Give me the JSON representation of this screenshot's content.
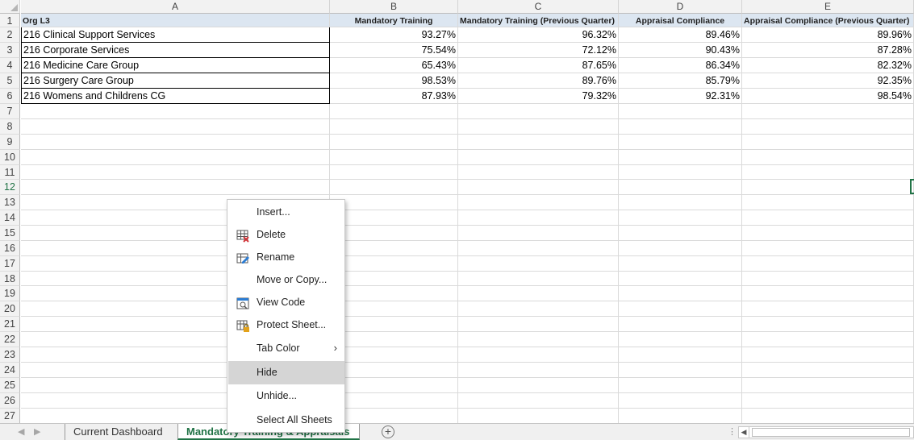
{
  "spreadsheet": {
    "columns": [
      "A",
      "B",
      "C",
      "D",
      "E"
    ],
    "row_numbers": [
      "1",
      "2",
      "3",
      "4",
      "5",
      "6",
      "7",
      "8",
      "9",
      "10",
      "11",
      "12",
      "13",
      "14",
      "15",
      "16",
      "17",
      "18",
      "19",
      "20",
      "21",
      "22",
      "23",
      "24",
      "25",
      "26",
      "27"
    ],
    "headers": [
      "Org L3",
      "Mandatory Training",
      "Mandatory Training  (Previous Quarter)",
      "Appraisal Compliance",
      "Appraisal Compliance  (Previous Quarter)"
    ],
    "rows": [
      [
        "216 Clinical Support Services",
        "93.27%",
        "96.32%",
        "89.46%",
        "89.96%"
      ],
      [
        "216 Corporate Services",
        "75.54%",
        "72.12%",
        "90.43%",
        "87.28%"
      ],
      [
        "216 Medicine Care Group",
        "65.43%",
        "87.65%",
        "86.34%",
        "82.32%"
      ],
      [
        "216 Surgery Care Group",
        "98.53%",
        "89.76%",
        "85.79%",
        "92.35%"
      ],
      [
        "216 Womens and Childrens CG",
        "87.93%",
        "79.32%",
        "92.31%",
        "98.54%"
      ]
    ],
    "selected_row": "12"
  },
  "context_menu": {
    "items": [
      {
        "label": "Insert...",
        "icon": "none"
      },
      {
        "label": "Delete",
        "icon": "delete-sheet-icon"
      },
      {
        "label": "Rename",
        "icon": "rename-sheet-icon"
      },
      {
        "label": "Move or Copy...",
        "icon": "none"
      },
      {
        "label": "View Code",
        "icon": "view-code-icon"
      },
      {
        "label": "Protect Sheet...",
        "icon": "protect-sheet-icon"
      },
      {
        "label": "Tab Color",
        "icon": "none",
        "submenu": true
      },
      {
        "label": "Hide",
        "icon": "none",
        "highlighted": true
      },
      {
        "label": "Unhide...",
        "icon": "none"
      },
      {
        "label": "Select All Sheets",
        "icon": "none"
      }
    ]
  },
  "sheet_tabs": {
    "tabs": [
      {
        "label": "Current Dashboard",
        "active": false
      },
      {
        "label": "Mandatory Training & Appraisals",
        "active": true
      }
    ],
    "add_sheet_symbol": "+"
  },
  "colors": {
    "accent_green": "#217346",
    "header_fill": "#dce6f1",
    "menu_hover": "#d5d5d5"
  }
}
